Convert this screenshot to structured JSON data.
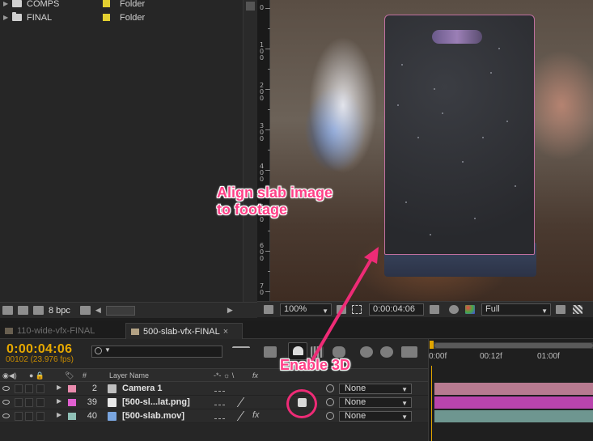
{
  "project": {
    "items": [
      {
        "name": "COMPS",
        "type": "Folder",
        "label_color": "#e3d030"
      },
      {
        "name": "FINAL",
        "type": "Folder",
        "label_color": "#e3d030"
      }
    ],
    "footer": {
      "bpc": "8 bpc"
    }
  },
  "viewer": {
    "ruler_labels": [
      "0",
      "1 0 0",
      "2 0 0",
      "3 0 0",
      "4 0 0",
      "5 0 0",
      "6 0 0",
      "7 0"
    ],
    "zoom": "100%",
    "timecode": "0:00:04:06",
    "resolution": "Full"
  },
  "tabs": [
    {
      "label": "110-wide-vfx-FINAL",
      "active": false
    },
    {
      "label": "500-slab-vfx-FINAL",
      "active": true
    }
  ],
  "timeline": {
    "current_time": "0:00:04:06",
    "frame_info": "00102 (23.976 fps)",
    "search_placeholder": "",
    "time_ruler": [
      "0:00f",
      "00:12f",
      "01:00f"
    ],
    "columns": {
      "number": "#",
      "layer_name": "Layer Name",
      "switches": "fx"
    },
    "layers": [
      {
        "number": "2",
        "name": "Camera 1",
        "color": "#e98bad",
        "parent": "None",
        "bar_color": "#b77a90"
      },
      {
        "number": "39",
        "name": "[500-sl...lat.png]",
        "color": "#e05fd0",
        "parent": "None",
        "bar_color": "#b944ad"
      },
      {
        "number": "40",
        "name": "[500-slab.mov]",
        "color": "#8fc0b6",
        "parent": "None",
        "bar_color": "#6e9690"
      }
    ]
  },
  "annotations": {
    "align": "Align slab image\nto footage",
    "enable_3d": "Enable 3D",
    "color": "#ff3f87"
  }
}
